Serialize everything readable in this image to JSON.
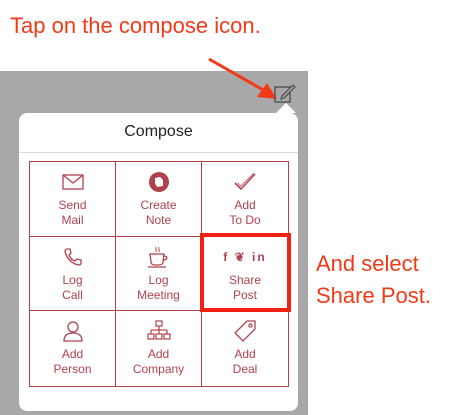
{
  "annotations": {
    "top": "Tap on the compose icon.",
    "right_line1": "And select",
    "right_line2": "Share Post."
  },
  "colors": {
    "annotation": "#f23a18",
    "accent": "#b0424e",
    "highlight": "#f21f14",
    "backdrop": "#a8a8a8"
  },
  "popover": {
    "title": "Compose",
    "items": [
      {
        "label": "Send\nMail",
        "icon": "envelope-icon"
      },
      {
        "label": "Create\nNote",
        "icon": "evernote-icon"
      },
      {
        "label": "Add\nTo Do",
        "icon": "checkmark-icon"
      },
      {
        "label": "Log\nCall",
        "icon": "phone-icon"
      },
      {
        "label": "Log\nMeeting",
        "icon": "coffee-cup-icon"
      },
      {
        "label": "Share\nPost",
        "icon": "social-icons",
        "glyphs": "f ❦ in"
      },
      {
        "label": "Add\nPerson",
        "icon": "person-icon"
      },
      {
        "label": "Add\nCompany",
        "icon": "org-chart-icon"
      },
      {
        "label": "Add\nDeal",
        "icon": "tag-icon"
      }
    ]
  }
}
